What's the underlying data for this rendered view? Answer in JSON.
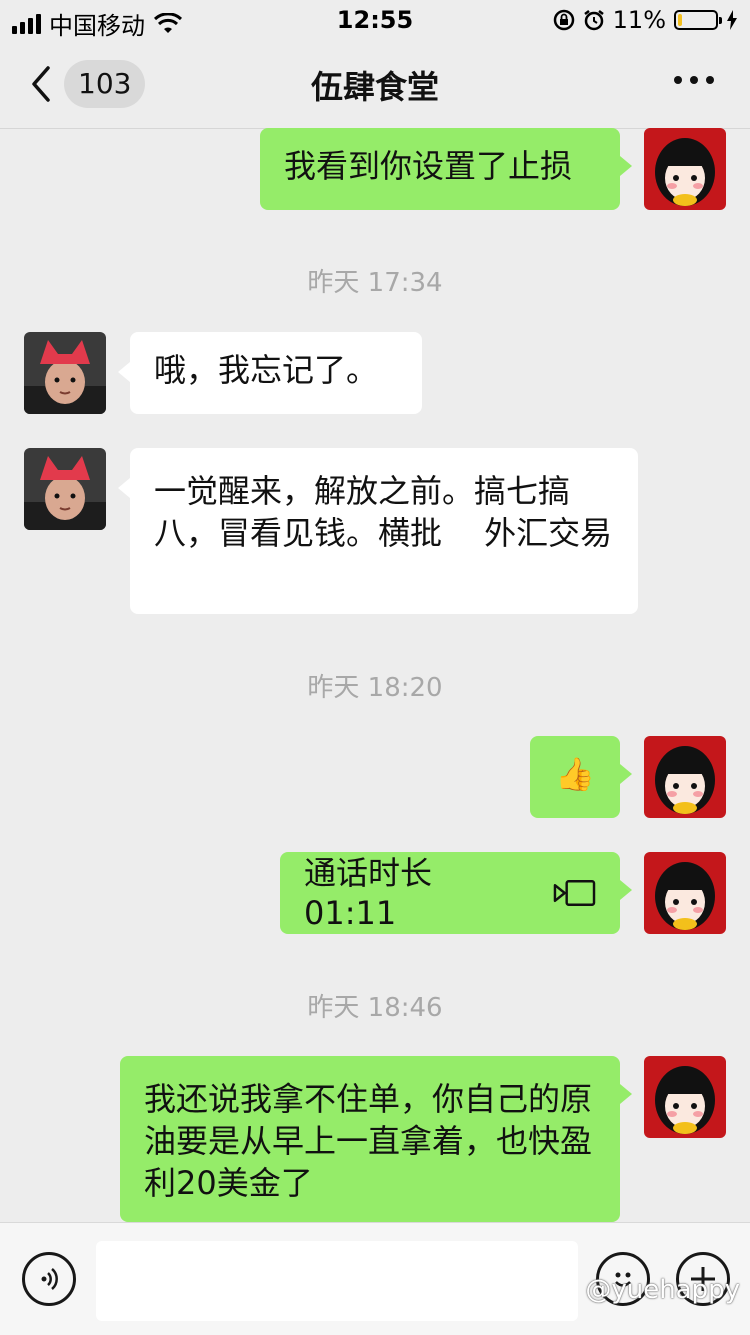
{
  "status_bar": {
    "carrier": "中国移动",
    "time": "12:55",
    "battery_text": "11%",
    "battery_level": 0.11
  },
  "nav": {
    "unread_count": "103",
    "title": "伍肆食堂"
  },
  "messages": [
    {
      "side": "right",
      "text": "我看到你设置了止损"
    },
    {
      "timestamp": "昨天 17:34"
    },
    {
      "side": "left",
      "text": "哦，我忘记了。"
    },
    {
      "side": "left",
      "text": "一觉醒来，解放之前。搞七搞八，冒看见钱。横批　 外汇交易"
    },
    {
      "timestamp": "昨天 18:20"
    },
    {
      "side": "right",
      "text": "👍"
    },
    {
      "side": "right",
      "text": "通话时长 01:11"
    },
    {
      "timestamp": "昨天 18:46"
    },
    {
      "side": "right",
      "text": "我还说我拿不住单，你自己的原油要是从早上一直拿着，也快盈利20美金了"
    }
  ],
  "input_bar": {
    "placeholder": ""
  },
  "watermark": "@yuehappy",
  "colors": {
    "sent_bubble": "#95ec69",
    "received_bubble": "#ffffff",
    "background": "#ededed"
  }
}
